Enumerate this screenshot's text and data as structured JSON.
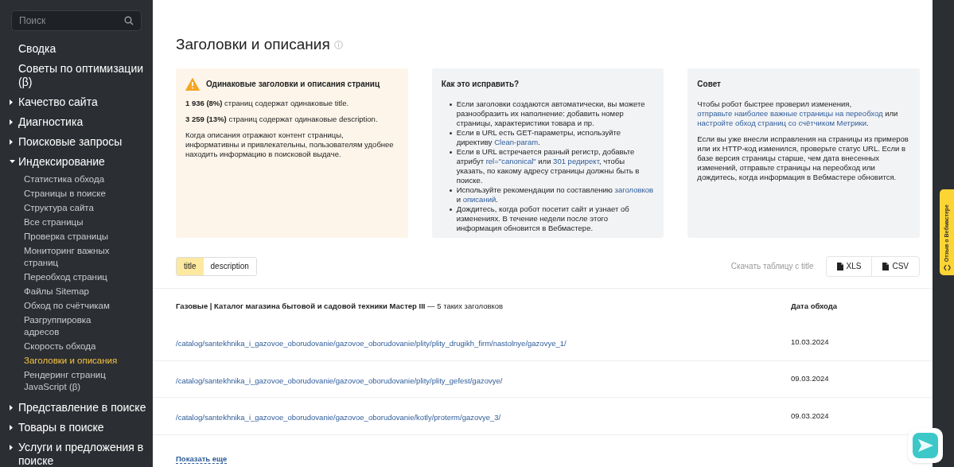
{
  "sidebar": {
    "search": {
      "placeholder": "Поиск"
    },
    "items": [
      {
        "kind": "page",
        "label": "Сводка"
      },
      {
        "kind": "page",
        "label": "Советы по оптимизации (β)"
      },
      {
        "kind": "section",
        "label": "Качество сайта",
        "expanded": false
      },
      {
        "kind": "section",
        "label": "Диагностика",
        "expanded": false
      },
      {
        "kind": "section",
        "label": "Поисковые запросы",
        "expanded": false
      },
      {
        "kind": "section",
        "label": "Индексирование",
        "expanded": true,
        "children": [
          {
            "label": "Статистика обхода",
            "selected": false
          },
          {
            "label": "Страницы в поиске",
            "selected": false
          },
          {
            "label": "Структура сайта",
            "selected": false
          },
          {
            "label": "Все страницы",
            "selected": false
          },
          {
            "label": "Проверка страницы",
            "selected": false
          },
          {
            "label": "Мониторинг важных страниц",
            "selected": false
          },
          {
            "label": "Переобход страниц",
            "selected": false
          },
          {
            "label": "Файлы Sitemap",
            "selected": false
          },
          {
            "label": "Обход по счётчикам",
            "selected": false
          },
          {
            "label": "Разгруппировка адресов",
            "selected": false
          },
          {
            "label": "Скорость обхода",
            "selected": false
          },
          {
            "label": "Заголовки и описания",
            "selected": true
          },
          {
            "label": "Рендеринг страниц JavaScript (β)",
            "selected": false
          }
        ]
      },
      {
        "kind": "section",
        "label": "Представление в поиске",
        "expanded": false
      },
      {
        "kind": "section",
        "label": "Товары в поиске",
        "expanded": false
      },
      {
        "kind": "section",
        "label": "Услуги и предложения в поиске",
        "expanded": false
      }
    ]
  },
  "page_title": "Заголовки и описания",
  "cards": [
    {
      "kind": "warning",
      "title": "Одинаковые заголовки и описания страниц",
      "paragraphs": [
        [
          {
            "kind": "text",
            "text": "**1 936 (8%)** страниц содержат одинаковые title."
          }
        ],
        [
          {
            "kind": "text",
            "text": "**3 259 (13%)** страниц содержат одинаковые description."
          }
        ],
        [
          {
            "kind": "text",
            "text": "Когда описания отражают контент страницы, информативны и привлекательны, пользователям удобнее находить информацию в поисковой выдаче."
          }
        ]
      ]
    },
    {
      "kind": "list",
      "title": "Как это исправить?",
      "bullets": [
        [
          {
            "kind": "text",
            "text": "Если заголовки создаются автоматически, вы можете разнообразить их наполнение: добавить номер страницы, характеристики товара и пр."
          }
        ],
        [
          {
            "kind": "text",
            "text": "Если в URL есть GET-параметры, используйте директиву "
          },
          {
            "kind": "link",
            "text": "Clean-param"
          },
          {
            "kind": "text",
            "text": "."
          }
        ],
        [
          {
            "kind": "text",
            "text": "Если в URL встречается разный регистр, добавьте атрибут "
          },
          {
            "kind": "link",
            "text": "rel=\"canonical\""
          },
          {
            "kind": "text",
            "text": " или "
          },
          {
            "kind": "link",
            "text": "301 редирект"
          },
          {
            "kind": "text",
            "text": ", чтобы указать, по какому адресу страницы должны быть в поиске."
          }
        ],
        [
          {
            "kind": "text",
            "text": "Используйте рекомендации по составлению "
          },
          {
            "kind": "link",
            "text": "заголовков"
          },
          {
            "kind": "text",
            "text": " и "
          },
          {
            "kind": "link",
            "text": "описаний"
          },
          {
            "kind": "text",
            "text": "."
          }
        ],
        [
          {
            "kind": "text",
            "text": "Дождитесь, когда робот посетит сайт и узнает об изменениях. В течение недели после этого информация обновится в Вебмастере."
          }
        ]
      ]
    },
    {
      "kind": "tip",
      "title": "Совет",
      "paragraphs": [
        [
          {
            "kind": "text",
            "text": "Чтобы робот быстрее проверил изменения, "
          },
          {
            "kind": "link",
            "text": "отправьте наиболее важные страницы на переобход"
          },
          {
            "kind": "text",
            "text": " или "
          },
          {
            "kind": "link",
            "text": "настройте обход страниц со счётчиком Метрики"
          },
          {
            "kind": "text",
            "text": "."
          }
        ],
        [
          {
            "kind": "text",
            "text": "Если вы уже внесли исправления на страницы из примеров или их HTTP-код изменился, проверьте статус URL. Если в базе версия страницы старше, чем дата внесенных изменений, отправьте страницы на переобход или дождитесь, когда информация в Вебмастере обновится."
          }
        ]
      ]
    }
  ],
  "tabs": [
    {
      "label": "title",
      "selected": true
    },
    {
      "label": "description",
      "selected": false
    }
  ],
  "download": {
    "label": "Скачать таблицу с title",
    "buttons": [
      "XLS",
      "CSV"
    ]
  },
  "table": {
    "group_title": "Газовые | Каталог магазина бытовой и садовой техники Мастер III",
    "group_count": "— 5 таких заголовков",
    "date_header": "Дата обхода",
    "rows": [
      {
        "url": "/catalog/santekhnika_i_gazovoe_oborudovanie/gazovoe_oborudovanie/plity/plity_drugikh_firm/nastolnye/gazovye_1/",
        "date": "10.03.2024"
      },
      {
        "url": "/catalog/santekhnika_i_gazovoe_oborudovanie/gazovoe_oborudovanie/plity/plity_gefest/gazovye/",
        "date": "09.03.2024"
      },
      {
        "url": "/catalog/santekhnika_i_gazovoe_oborudovanie/gazovoe_oborudovanie/kotly/proterm/gazovye_3/",
        "date": "09.03.2024"
      }
    ]
  },
  "show_more": "Показать еще",
  "feedback_tab": "Отзыв о Вебмастере"
}
